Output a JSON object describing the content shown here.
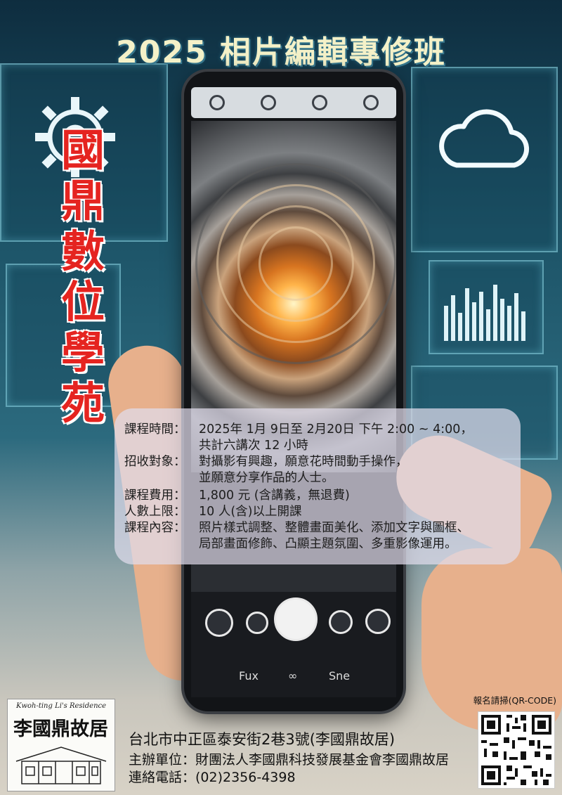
{
  "poster": {
    "title": "2025 相片編輯專修班",
    "org_vertical": [
      "國",
      "鼎",
      "數",
      "位",
      "學",
      "苑"
    ],
    "phone_ui": {
      "labels": [
        "Fux",
        "∞",
        "Sne"
      ]
    },
    "course": {
      "time_label": "課程時間：",
      "time_value": "2025年 1月 9日至 2月20日 下午 2:00 ~ 4:00，",
      "time_extra": "共計六講次 12 小時",
      "target_label": "招收對象：",
      "target_value": "對攝影有興趣，願意花時間動手操作，",
      "target_extra": "並願意分享作品的人士。",
      "fee_label": "課程費用：",
      "fee_value": "1,800 元 (含講義，無退費)",
      "limit_label": "人數上限：",
      "limit_value": "10 人(含)以上開課",
      "content_label": "課程內容：",
      "content_value": "照片樣式調整、整體畫面美化、添加文字與圖框、",
      "content_extra": "局部畫面修飾、凸顯主題氛圍、多重影像運用。"
    },
    "logo": {
      "en": "Kwoh-ting Li's Residence",
      "zh": "李國鼎故居"
    },
    "footer": {
      "address": "台北市中正區泰安街2巷3號(李國鼎故居)",
      "organizer": "主辦單位：財團法人李國鼎科技發展基金會李國鼎故居",
      "phone": "連絡電話：(02)2356-4398",
      "qr_label": "報名請掃(QR-CODE)"
    }
  }
}
